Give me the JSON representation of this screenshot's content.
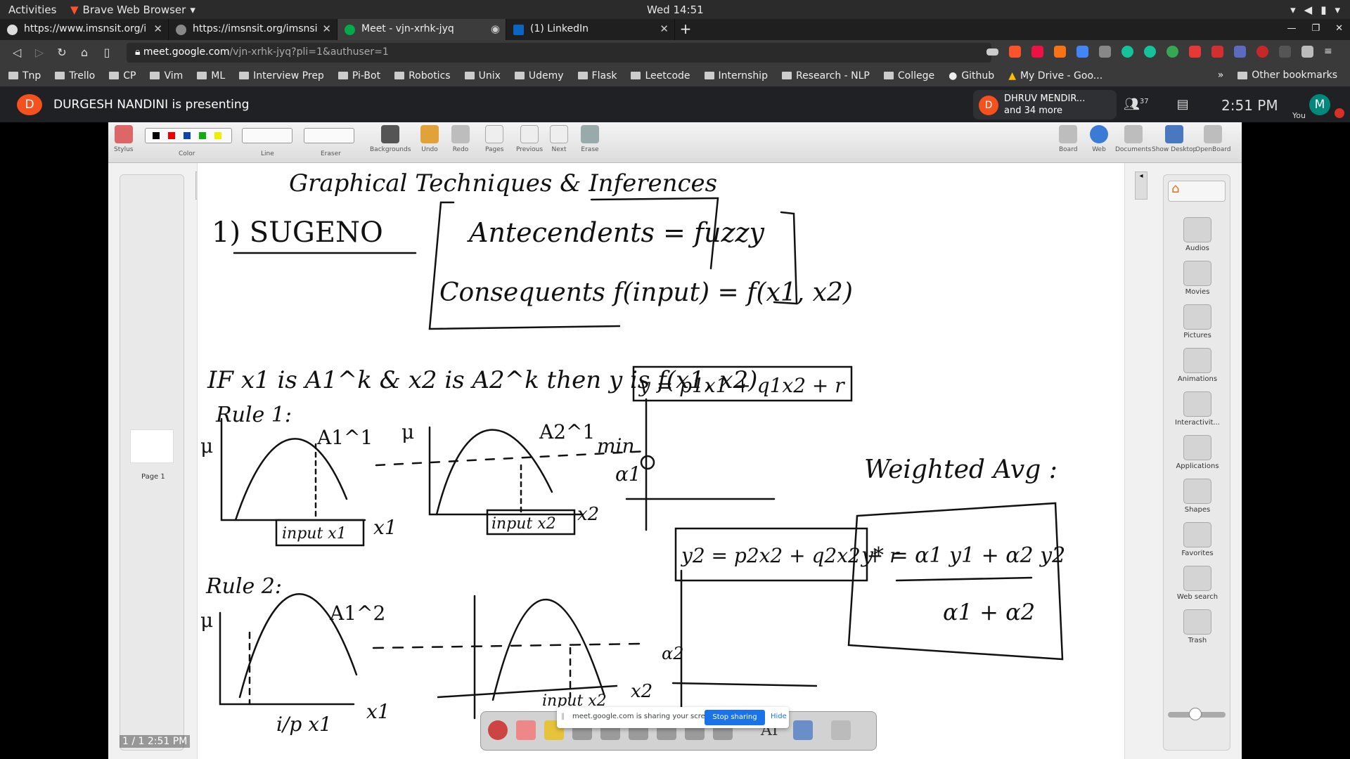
{
  "system": {
    "activities": "Activities",
    "app_menu": "Brave Web Browser",
    "clock": "Wed 14:51"
  },
  "tabs": [
    {
      "title": "https://www.imsnsit.org/i"
    },
    {
      "title": "https://imsnsit.org/imsnsi"
    },
    {
      "title": "Meet - vjn-xrhk-jyq"
    },
    {
      "title": "(1) LinkedIn"
    }
  ],
  "address": {
    "domain": "meet.google.com",
    "path": "/vjn-xrhk-jyq?pli=1&authuser=1"
  },
  "bookmarks": [
    "Tnp",
    "Trello",
    "CP",
    "Vim",
    "ML",
    "Interview Prep",
    "Pi-Bot",
    "Robotics",
    "Unix",
    "Udemy",
    "Flask",
    "Leetcode",
    "Internship",
    "Research - NLP",
    "College",
    "Github",
    "My Drive - Goo..."
  ],
  "bookmarks_more": "»",
  "other_bookmarks": "Other bookmarks",
  "meet": {
    "presenter_initial": "D",
    "presenting": "DURGESH NANDINI is presenting",
    "participant_name": "DHRUV MENDIR...",
    "participant_more": "and 34 more",
    "participant_count": "37",
    "time": "2:51 PM",
    "self_initial": "M",
    "self_label": "You"
  },
  "openboard": {
    "toolbar_labels": [
      "Stylus",
      "Color",
      "Line",
      "Eraser",
      "Backgrounds",
      "Undo",
      "Redo",
      "Pages",
      "Previous",
      "Next",
      "Erase"
    ],
    "right_toolbar_labels": [
      "Board",
      "Web",
      "Documents",
      "Show Desktop",
      "OpenBoard"
    ],
    "page_label": "Page 1",
    "page_counter": "1 / 1 2:51 PM",
    "library": [
      "Audios",
      "Movies",
      "Pictures",
      "Animations",
      "Interactivit...",
      "Applications",
      "Shapes",
      "Favorites",
      "Web search",
      "Trash"
    ],
    "drawing_tool_labels": [
      "AI"
    ]
  },
  "share_notice": {
    "message": "meet.google.com is sharing your screen.",
    "stop": "Stop sharing",
    "hide": "Hide"
  },
  "whiteboard": {
    "title": "Graphical Techniques & Inferences",
    "sugeno": "1) SUGENO",
    "antecedents": "Antecendents = fuzzy",
    "consequents": "Consequents f(input) = f(x1, x2)",
    "rule_statement": "IF x1 is A1^k & x2 is A2^k then y is f(x1, x2)",
    "y_formula": "y = p1x1 + q1x2 + r",
    "rule1": "Rule 1:",
    "rule2": "Rule 2:",
    "mu": "μ",
    "a11": "A1^1",
    "a21": "A2^1",
    "a12": "A1^2",
    "min": "min",
    "alpha1": "α1",
    "alpha2": "α2",
    "input_x1": "input x1",
    "input_x2": "input x2",
    "x1": "x1",
    "x2": "x2",
    "ip_x1": "i/p x1",
    "input_x2_b": "input x2",
    "y2_formula": "y2 = p2x2 + q2x2 + r",
    "weighted_avg": "Weighted Avg :",
    "y_star": "y* = α1 y1 + α2 y2",
    "denominator": "α1 + α2"
  }
}
